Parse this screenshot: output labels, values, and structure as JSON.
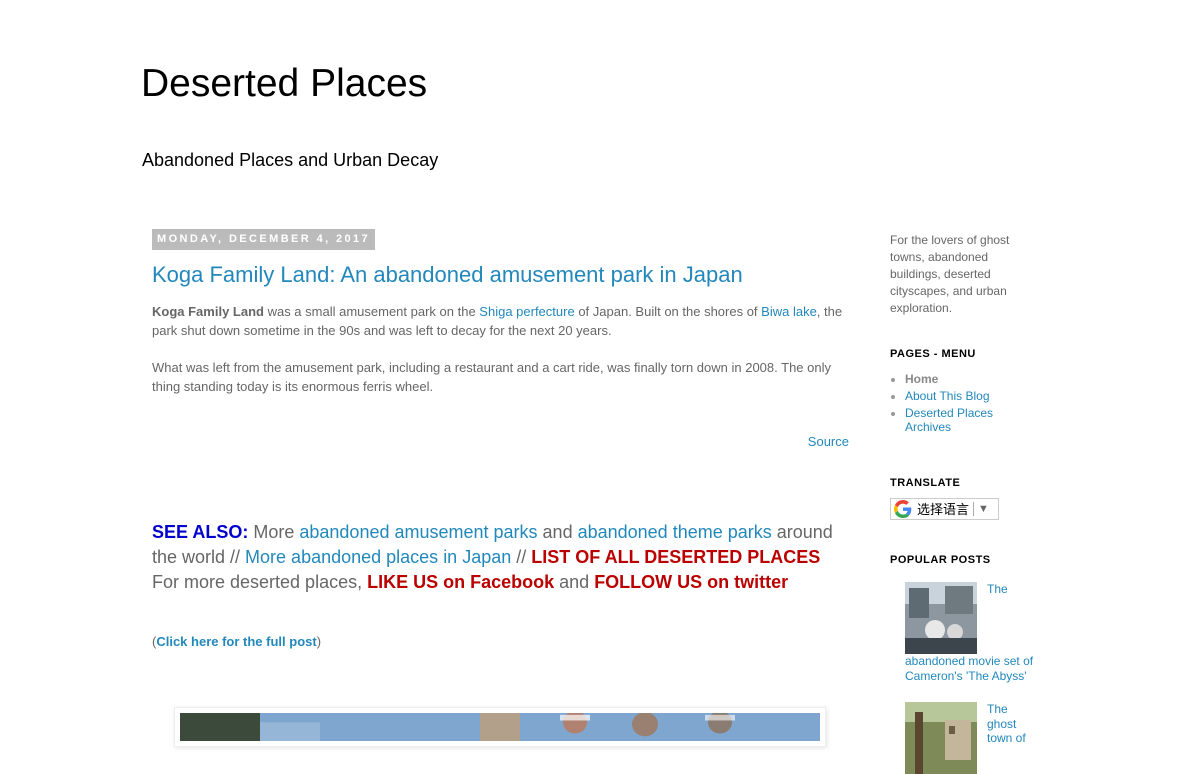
{
  "header": {
    "title": "Deserted Places",
    "description": "Abandoned Places and Urban Decay"
  },
  "post": {
    "date": "MONDAY, DECEMBER 4, 2017",
    "title": "Koga Family Land: An abandoned amusement park in Japan",
    "p1_bold": "Koga Family Land",
    "p1_text1": " was a small amusement park on the ",
    "p1_link1": "Shiga perfecture",
    "p1_text2": " of Japan. Built on the shores of ",
    "p1_link2": "Biwa lake",
    "p1_text3": ", the park shut down sometime in the 90s and was left to decay for the next 20 years.",
    "p2": "What was left from the amusement park, including a restaurant and a cart ride, was finally torn down in 2008. The only thing standing today is its enormous ferris wheel.",
    "source_link": "Source"
  },
  "see_also": {
    "label": "SEE ALSO:",
    "t1": " More ",
    "link1": "abandoned amusement parks",
    "t2": " and ",
    "link2": "abandoned theme parks",
    "t3": " around the world // ",
    "link3": "More abandoned places in Japan",
    "t4": " // ",
    "link4": "LIST OF ALL DESERTED PLACES",
    "t5": " For more deserted places, ",
    "link5": "LIKE US on Facebook",
    "t6": " and ",
    "link6": "FOLLOW US on twitter"
  },
  "full_post": {
    "open": "(",
    "link": "Click here for the full post",
    "close": ")"
  },
  "sidebar": {
    "description": "For the lovers of ghost towns, abandoned buildings, deserted cityscapes, and urban exploration.",
    "pages_title": "PAGES - MENU",
    "pages": [
      {
        "label": "Home"
      },
      {
        "label": "About This Blog"
      },
      {
        "label": "Deserted Places Archives"
      }
    ],
    "translate_title": "TRANSLATE",
    "translate_label": "选择语言",
    "translate_arrow": "▼",
    "popular_title": "POPULAR POSTS",
    "popular": [
      {
        "title": "The abandoned movie set of Cameron's 'The Abyss'"
      },
      {
        "title": "The ghost town of"
      }
    ]
  },
  "icons": {
    "translate": "google-g-icon",
    "dropdown": "dropdown-arrow-icon"
  },
  "colors": {
    "link": "#2288bb",
    "text": "#666666",
    "see_also_blue": "#0000cc",
    "see_also_red": "#bb0000",
    "date_bg": "#bbbbbb"
  }
}
